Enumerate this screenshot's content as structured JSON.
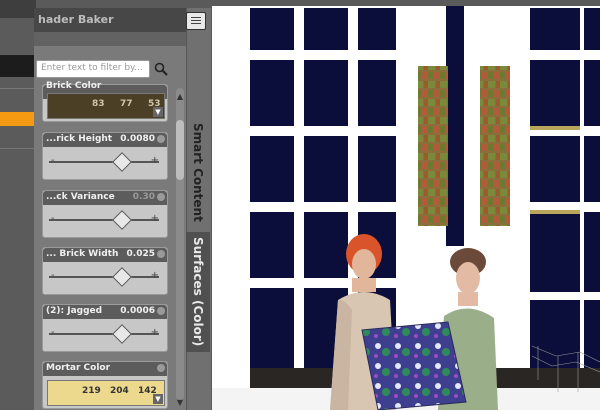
{
  "panel": {
    "title": "hader Baker"
  },
  "filter": {
    "placeholder": "Enter text to filter by..."
  },
  "tabs": [
    {
      "label": "Smart Content"
    },
    {
      "label": "Surfaces (Color)"
    }
  ],
  "properties": {
    "brick_color": {
      "name": "Brick Color",
      "r": "83",
      "g": "77",
      "b": "53",
      "color": "#4b3f25"
    },
    "brick_height": {
      "name": "...rick Height",
      "value": "0.0080",
      "level": 0.55
    },
    "brick_variance": {
      "name": "...ck Variance",
      "value": "0.30",
      "level": 0.55
    },
    "brick_width": {
      "name": "... Brick Width",
      "value": "0.025",
      "level": 0.55
    },
    "jagged": {
      "name": "(2): Jagged",
      "value": "0.0006",
      "level": 0.55
    },
    "mortar_color": {
      "name": "Mortar Color",
      "r": "219",
      "g": "204",
      "b": "142",
      "color": "#ecd98e"
    }
  }
}
